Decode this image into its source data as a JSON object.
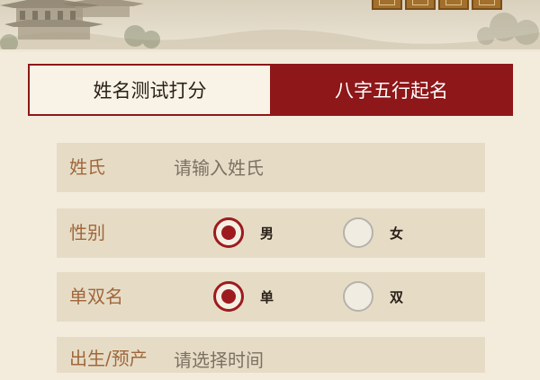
{
  "header": {
    "seal_count": 4
  },
  "tabs": [
    {
      "label": "姓名测试打分",
      "active": false
    },
    {
      "label": "八字五行起名",
      "active": true
    }
  ],
  "form": {
    "surname": {
      "label": "姓氏",
      "placeholder": "请输入姓氏",
      "value": ""
    },
    "gender": {
      "label": "性别",
      "options": [
        {
          "label": "男",
          "checked": true
        },
        {
          "label": "女",
          "checked": false
        }
      ]
    },
    "name_type": {
      "label": "单双名",
      "options": [
        {
          "label": "单",
          "checked": true
        },
        {
          "label": "双",
          "checked": false
        }
      ]
    },
    "birth": {
      "label": "出生/预产",
      "placeholder": "请选择时间"
    }
  },
  "colors": {
    "accent_red": "#8e1719",
    "label_brown": "#a0673b",
    "field_bg": "#e6dcc6",
    "page_bg": "#f3ecdc"
  }
}
